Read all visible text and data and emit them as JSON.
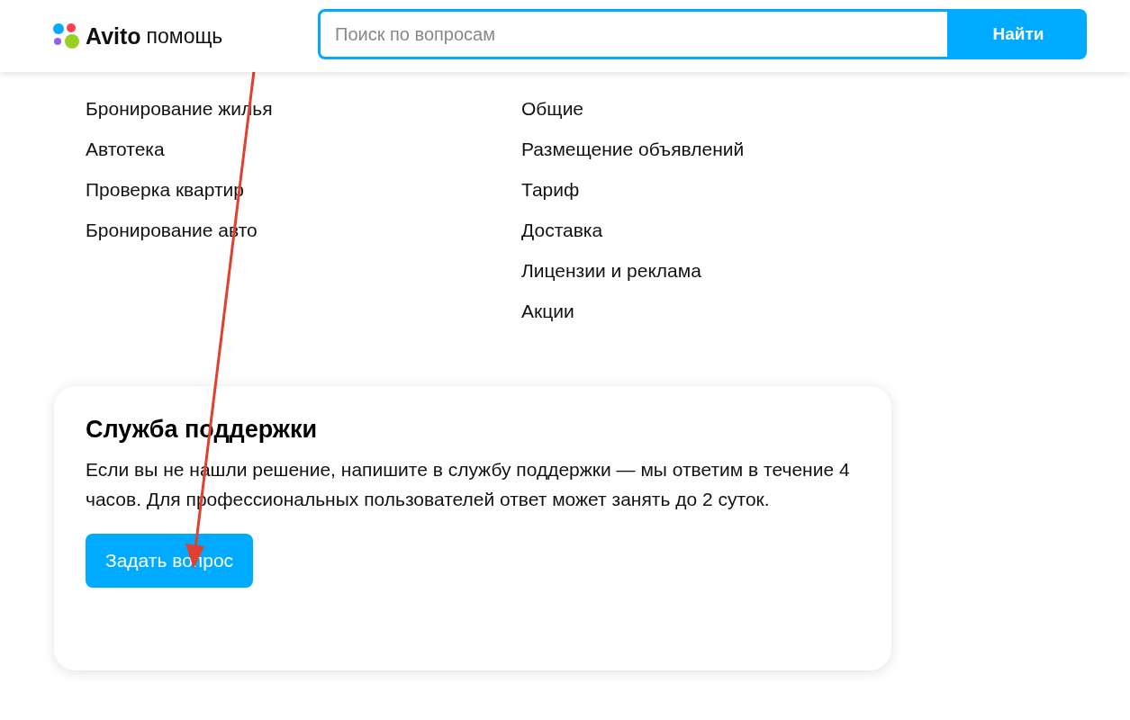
{
  "header": {
    "logo": {
      "brand": "Avito",
      "section": "помощь"
    },
    "search": {
      "placeholder": "Поиск по вопросам",
      "button": "Найти"
    }
  },
  "sections": [
    {
      "items": [
        "Бронирование жилья",
        "Автотека",
        "Проверка квартир",
        "Бронирование авто"
      ]
    },
    {
      "items": [
        "Общие",
        "Размещение объявлений",
        "Тариф",
        "Доставка",
        "Лицензии и реклама",
        "Акции"
      ]
    }
  ],
  "support": {
    "title": "Служба поддержки",
    "text": "Если вы не нашли решение, напишите в службу поддержки — мы ответим в течение 4 часов. Для профессиональных пользователей ответ может занять до 2 суток.",
    "button": "Задать вопрос"
  }
}
